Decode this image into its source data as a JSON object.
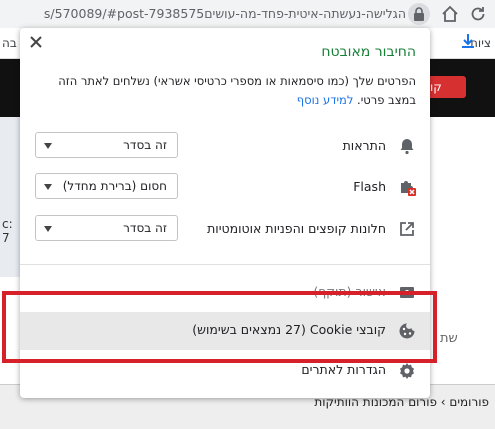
{
  "browser": {
    "url": "s/570089/#post-7938575הגלישה-נעשתה-איטית-פחד-מה-עושים",
    "bookmarks": [
      "ציות",
      "בה"
    ]
  },
  "page": {
    "register_button": "קו",
    "footer_tabs": "פורומים › פורום המכונות הוותיקות",
    "side_text": "שת",
    "left_frag": "c: 7"
  },
  "popup": {
    "close_label": "×",
    "title": "החיבור מאובטח",
    "description": "הפרטים שלך (כמו סיסמאות או מספרי כרטיסי אשראי) נשלחים לאתר הזה במצב פרטי.",
    "learn_more": "למידע נוסף",
    "permissions": [
      {
        "label": "התראות",
        "value": "זה בסדר",
        "icon": "bell-icon"
      },
      {
        "label": "Flash",
        "value": "חסום (ברירת מחדל)",
        "icon": "puzzle-blocked-icon"
      },
      {
        "label": "חלונות קופצים והפניות אוטומטיות",
        "value": "זה בסדר",
        "icon": "external-link-icon"
      }
    ],
    "menu": [
      {
        "label": "אישור (תוקף)",
        "icon": "certificate-icon"
      },
      {
        "label": "קובצי Cookie (27 נמצאים בשימוש)",
        "icon": "cookie-icon"
      },
      {
        "label": "הגדרות לאתרים",
        "icon": "gear-icon"
      }
    ]
  },
  "colors": {
    "secure_title": "#188038",
    "link": "#1a73e8",
    "highlight": "#d6212b"
  }
}
